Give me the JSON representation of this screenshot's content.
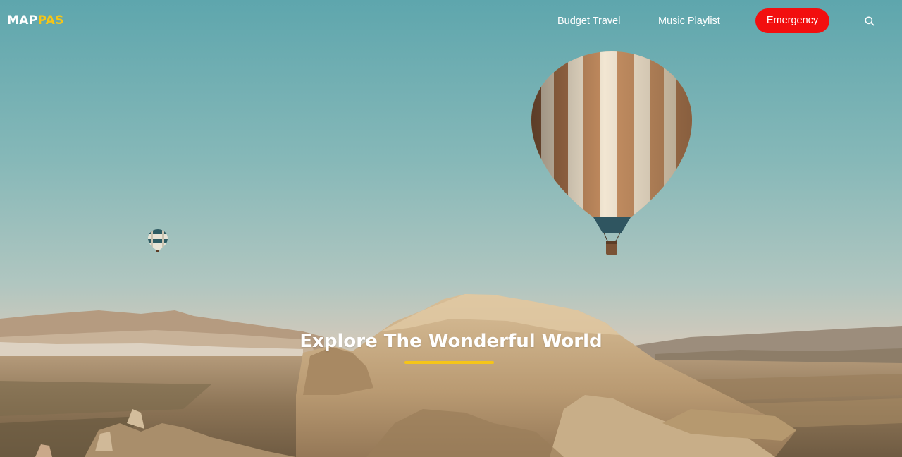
{
  "brand": {
    "logo_part1": "MAP",
    "logo_part2": "PAS",
    "logo_colors": {
      "part1": "#ffffff",
      "part2": "#f5c518"
    }
  },
  "nav": {
    "links": [
      {
        "label": "Budget Travel"
      },
      {
        "label": "Music Playlist"
      }
    ],
    "emergency_label": "Emergency",
    "emergency_color": "#f20f0f",
    "search_icon": "search-icon"
  },
  "hero": {
    "title": "Explore The Wonderful World",
    "accent_color": "#f5c518",
    "background": "hot-air-balloons-over-valley-photo"
  }
}
